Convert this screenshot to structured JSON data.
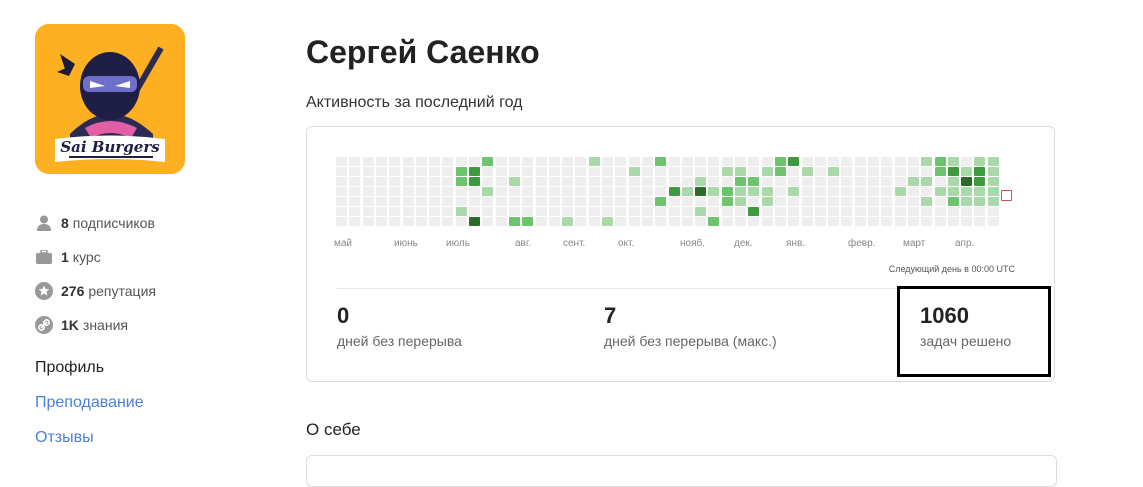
{
  "profile": {
    "name": "Сергей Саенко",
    "logo_text": "Sai Burgers"
  },
  "stats": [
    {
      "icon": "user-icon",
      "num": "8",
      "label": "подписчиков"
    },
    {
      "icon": "briefcase-icon",
      "num": "1",
      "label": "курс"
    },
    {
      "icon": "star-icon",
      "num": "276",
      "label": "репутация"
    },
    {
      "icon": "link-icon",
      "num": "1K",
      "label": "знания"
    }
  ],
  "nav": {
    "profile": "Профиль",
    "teaching": "Преподавание",
    "reviews": "Отзывы"
  },
  "activity": {
    "title": "Активность за последний год",
    "months": [
      "май",
      "июнь",
      "июль",
      "авг.",
      "сент.",
      "окт.",
      "нояб.",
      "дек.",
      "янв.",
      "февр.",
      "март",
      "апр."
    ],
    "next_day": "Следующий день в 00:00 UTC",
    "levels_legend": [
      "#eeeeee",
      "#a9d9a9",
      "#6cc56c",
      "#3f9a3f",
      "#2a6b2a"
    ],
    "weeks": 50,
    "days_per_week": 7,
    "active_cells": [
      {
        "week": 9,
        "day": 1,
        "level": 2
      },
      {
        "week": 9,
        "day": 2,
        "level": 2
      },
      {
        "week": 9,
        "day": 5,
        "level": 1
      },
      {
        "week": 10,
        "day": 1,
        "level": 3
      },
      {
        "week": 10,
        "day": 2,
        "level": 3
      },
      {
        "week": 10,
        "day": 6,
        "level": 4
      },
      {
        "week": 11,
        "day": 0,
        "level": 2
      },
      {
        "week": 11,
        "day": 3,
        "level": 1
      },
      {
        "week": 13,
        "day": 2,
        "level": 1
      },
      {
        "week": 13,
        "day": 6,
        "level": 2
      },
      {
        "week": 14,
        "day": 6,
        "level": 2
      },
      {
        "week": 17,
        "day": 6,
        "level": 1
      },
      {
        "week": 19,
        "day": 0,
        "level": 1
      },
      {
        "week": 20,
        "day": 6,
        "level": 1
      },
      {
        "week": 22,
        "day": 1,
        "level": 1
      },
      {
        "week": 24,
        "day": 0,
        "level": 2
      },
      {
        "week": 24,
        "day": 4,
        "level": 2
      },
      {
        "week": 25,
        "day": 3,
        "level": 3
      },
      {
        "week": 26,
        "day": 3,
        "level": 1
      },
      {
        "week": 27,
        "day": 2,
        "level": 1
      },
      {
        "week": 27,
        "day": 3,
        "level": 4
      },
      {
        "week": 27,
        "day": 5,
        "level": 1
      },
      {
        "week": 28,
        "day": 3,
        "level": 1
      },
      {
        "week": 28,
        "day": 6,
        "level": 2
      },
      {
        "week": 29,
        "day": 1,
        "level": 1
      },
      {
        "week": 29,
        "day": 3,
        "level": 2
      },
      {
        "week": 29,
        "day": 4,
        "level": 2
      },
      {
        "week": 30,
        "day": 1,
        "level": 1
      },
      {
        "week": 30,
        "day": 2,
        "level": 2
      },
      {
        "week": 30,
        "day": 3,
        "level": 1
      },
      {
        "week": 30,
        "day": 4,
        "level": 1
      },
      {
        "week": 31,
        "day": 2,
        "level": 2
      },
      {
        "week": 31,
        "day": 3,
        "level": 1
      },
      {
        "week": 31,
        "day": 5,
        "level": 3
      },
      {
        "week": 32,
        "day": 1,
        "level": 1
      },
      {
        "week": 32,
        "day": 3,
        "level": 1
      },
      {
        "week": 32,
        "day": 4,
        "level": 1
      },
      {
        "week": 33,
        "day": 0,
        "level": 2
      },
      {
        "week": 33,
        "day": 1,
        "level": 2
      },
      {
        "week": 34,
        "day": 0,
        "level": 3
      },
      {
        "week": 34,
        "day": 3,
        "level": 1
      },
      {
        "week": 35,
        "day": 1,
        "level": 1
      },
      {
        "week": 37,
        "day": 1,
        "level": 1
      },
      {
        "week": 42,
        "day": 3,
        "level": 1
      },
      {
        "week": 43,
        "day": 2,
        "level": 1
      },
      {
        "week": 44,
        "day": 0,
        "level": 1
      },
      {
        "week": 44,
        "day": 2,
        "level": 1
      },
      {
        "week": 44,
        "day": 4,
        "level": 1
      },
      {
        "week": 45,
        "day": 0,
        "level": 2
      },
      {
        "week": 45,
        "day": 1,
        "level": 2
      },
      {
        "week": 45,
        "day": 3,
        "level": 1
      },
      {
        "week": 46,
        "day": 0,
        "level": 1
      },
      {
        "week": 46,
        "day": 1,
        "level": 3
      },
      {
        "week": 46,
        "day": 2,
        "level": 1
      },
      {
        "week": 46,
        "day": 3,
        "level": 1
      },
      {
        "week": 46,
        "day": 4,
        "level": 2
      },
      {
        "week": 47,
        "day": 1,
        "level": 1
      },
      {
        "week": 47,
        "day": 2,
        "level": 4
      },
      {
        "week": 47,
        "day": 3,
        "level": 1
      },
      {
        "week": 47,
        "day": 4,
        "level": 1
      },
      {
        "week": 48,
        "day": 0,
        "level": 1
      },
      {
        "week": 48,
        "day": 1,
        "level": 3
      },
      {
        "week": 48,
        "day": 2,
        "level": 3
      },
      {
        "week": 48,
        "day": 3,
        "level": 1
      },
      {
        "week": 48,
        "day": 4,
        "level": 1
      },
      {
        "week": 49,
        "day": 0,
        "level": 1
      },
      {
        "week": 49,
        "day": 1,
        "level": 1
      },
      {
        "week": 49,
        "day": 2,
        "level": 1
      },
      {
        "week": 49,
        "day": 3,
        "level": 1
      },
      {
        "week": 49,
        "day": 4,
        "level": 1
      }
    ]
  },
  "metrics": [
    {
      "value": "0",
      "label": "дней без перерыва"
    },
    {
      "value": "7",
      "label": "дней без перерыва (макс.)"
    },
    {
      "value": "1060",
      "label": "задач решено"
    }
  ],
  "about": {
    "title": "О себе"
  }
}
